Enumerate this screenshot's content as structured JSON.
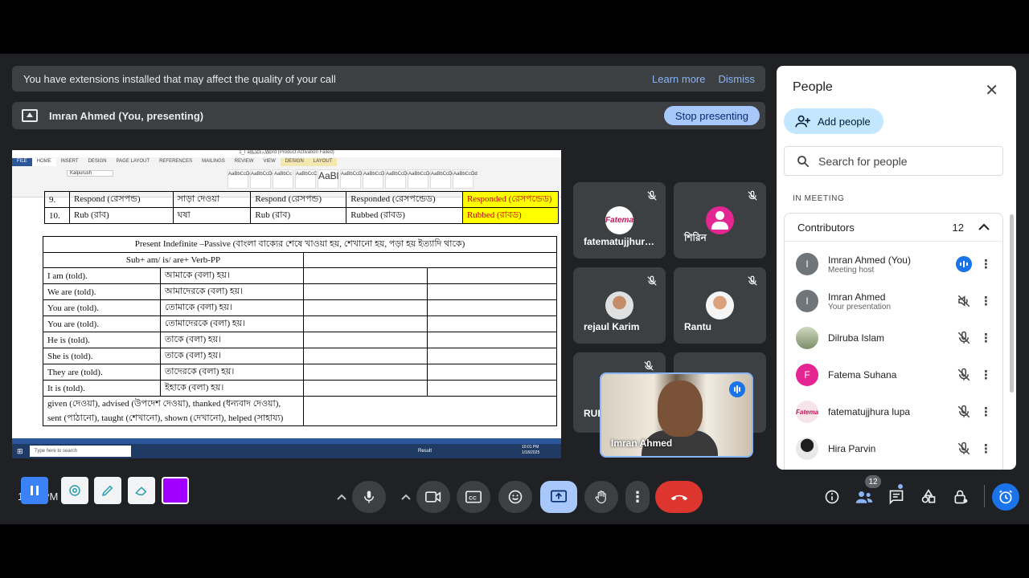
{
  "banner": {
    "message": "You have extensions installed that may affect the quality of your call",
    "learn_more": "Learn more",
    "dismiss": "Dismiss"
  },
  "presenting": {
    "label": "Imran Ahmed (You, presenting)",
    "stop": "Stop presenting"
  },
  "word": {
    "title": "1_I am V3 - Word (Product Activation Failed)",
    "table_tools": "TABLE TOOLS",
    "tabs": [
      "FILE",
      "HOME",
      "INSERT",
      "DESIGN",
      "PAGE LAYOUT",
      "REFERENCES",
      "MAILINGS",
      "REVIEW",
      "VIEW",
      "DESIGN",
      "LAYOUT"
    ],
    "font": "Kalpurush",
    "styles": [
      "AaBbCcDd",
      "AaBbCcDd",
      "AaBbCc",
      "AaBbCcC",
      "AaBl",
      "AaBbCcD",
      "AaBbCcD",
      "AaBbCcDd",
      "AaBbCcDd",
      "AaBbCcDd",
      "AaBbCcDd"
    ],
    "verb_rows": [
      [
        "9.",
        "Respond (রেসপন্ড)",
        "সাড়া দেওয়া",
        "Respond (রেসপন্ড)",
        "Responded (রেসপন্ডেড)",
        "Responded (রেসপন্ডেড)"
      ],
      [
        "10.",
        "Rub (রাব)",
        "ঘষা",
        "Rub (রাব)",
        "Rubbed (রাবড)",
        "Rubbed (রাবড)"
      ]
    ],
    "passive_title": "Present Indefinite –Passive (বাংলা বাক্যের শেষে খাওয়া হয়, শেখানো হয়, পড়া হয় ইত্যাদি থাকে)",
    "formula": "Sub+ am/ is/ are+ Verb-PP",
    "passive_rows": [
      [
        "I am (told).",
        "আমাকে (বলা) হয়।"
      ],
      [
        "We are (told).",
        "আমাদেরকে (বলা) হয়।"
      ],
      [
        "You are (told).",
        "তোমাকে (বলা) হয়।"
      ],
      [
        "You are (told).",
        "তোমাদেরকে (বলা) হয়।"
      ],
      [
        "He is (told).",
        "তাকে (বলা) হয়।"
      ],
      [
        "She is (told).",
        "তাকে (বলা) হয়।"
      ],
      [
        "They are (told).",
        "তাদেরকে (বলা) হয়।"
      ],
      [
        "It is (told).",
        "ইহাকে (বলা) হয়।"
      ]
    ],
    "examples_1": "given (দেওয়া), advised (উপদেশ দেওয়া), thanked (ধন্যবাদ দেওয়া),",
    "examples_2": "sent (পাঠানো), taught (শেখানো), shown (দেখানো), helped (সাহায্য)",
    "taskbar_search": "Type here to search",
    "taskbar_result": "Result",
    "taskbar_time": "10:01 PM",
    "taskbar_date": "1/18/2025"
  },
  "tiles": [
    {
      "name": "fatematujjhur…",
      "avatar_text": "Fatema"
    },
    {
      "name": "শিরিন"
    },
    {
      "name": "rejaul Karim"
    },
    {
      "name": "Rantu"
    },
    {
      "name": "RUH"
    }
  ],
  "self_tile": {
    "name": "Imran Ahmed"
  },
  "people": {
    "title": "People",
    "add_people": "Add people",
    "search_placeholder": "Search for people",
    "in_meeting": "IN MEETING",
    "group_title": "Contributors",
    "group_count": "12",
    "list": [
      {
        "name": "Imran Ahmed (You)",
        "sub": "Meeting host",
        "initial": "I",
        "color": "#70757a"
      },
      {
        "name": "Imran Ahmed",
        "sub": "Your presentation",
        "initial": "I",
        "color": "#70757a"
      },
      {
        "name": "Dilruba Islam",
        "sub": "",
        "initial": "",
        "color": "#a3b18a"
      },
      {
        "name": "Fatema Suhana",
        "sub": "",
        "initial": "F",
        "color": "#e52592"
      },
      {
        "name": "fatematujjhura lupa",
        "sub": "",
        "initial": "",
        "color": "#f1d6dc"
      },
      {
        "name": "Hira Parvin",
        "sub": "",
        "initial": "",
        "color": "#1f1f1f"
      }
    ]
  },
  "bottom": {
    "time_partial": "1",
    "meeting_partial": "PM",
    "meeting_partial_2": "w",
    "meeting_partial_3": "u",
    "participant_badge": "12",
    "accent": "#8ab4f8",
    "end_call_color": "#dc362e"
  }
}
